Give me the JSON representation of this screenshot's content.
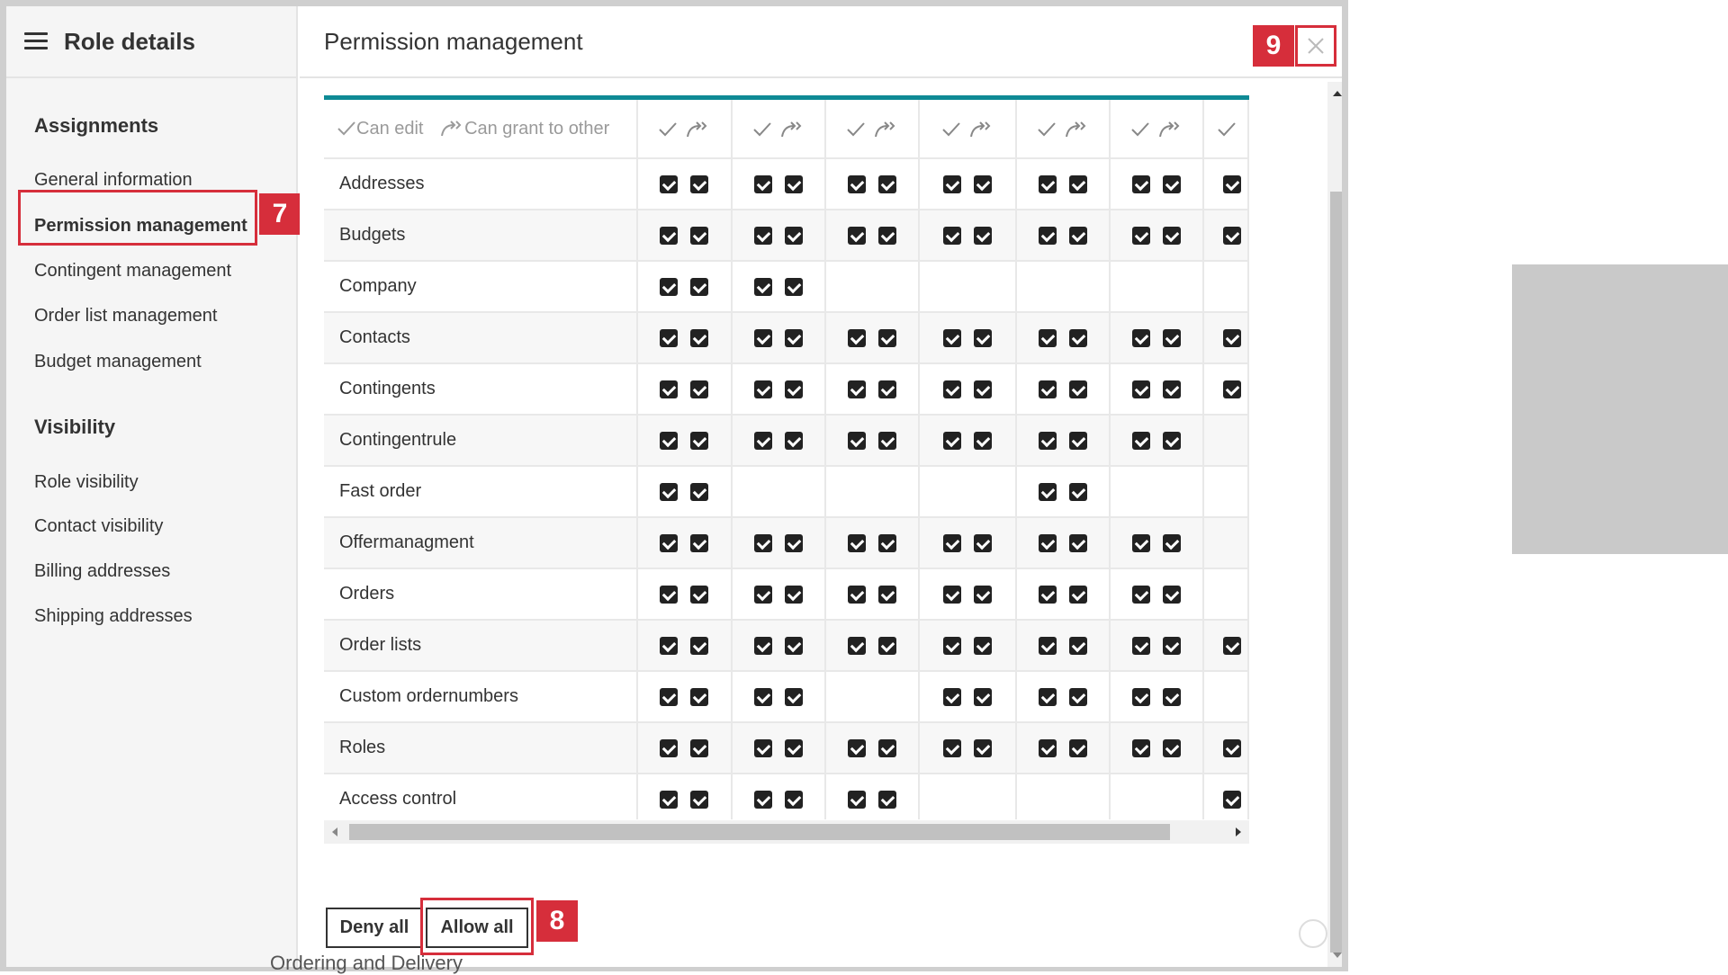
{
  "sidebar": {
    "title": "Role details",
    "sections": [
      {
        "title": "Assignments",
        "items": [
          "General information",
          "Permission management",
          "Contingent management",
          "Order list management",
          "Budget management"
        ]
      },
      {
        "title": "Visibility",
        "items": [
          "Role visibility",
          "Contact visibility",
          "Billing addresses",
          "Shipping addresses"
        ]
      }
    ],
    "active_item": "Permission management"
  },
  "main": {
    "title": "Permission management",
    "legend": {
      "can_edit": "Can edit",
      "can_grant": "Can grant to other"
    },
    "rows": [
      {
        "label": "Addresses",
        "cols": [
          true,
          true,
          true,
          true,
          true,
          true,
          true
        ]
      },
      {
        "label": "Budgets",
        "cols": [
          true,
          true,
          true,
          true,
          true,
          true,
          true
        ]
      },
      {
        "label": "Company",
        "cols": [
          true,
          true,
          false,
          false,
          false,
          false,
          false
        ]
      },
      {
        "label": "Contacts",
        "cols": [
          true,
          true,
          true,
          true,
          true,
          true,
          true
        ]
      },
      {
        "label": "Contingents",
        "cols": [
          true,
          true,
          true,
          true,
          true,
          true,
          true
        ]
      },
      {
        "label": "Contingentrule",
        "cols": [
          true,
          true,
          true,
          true,
          true,
          true,
          false
        ]
      },
      {
        "label": "Fast order",
        "cols": [
          true,
          false,
          false,
          false,
          true,
          false,
          false
        ]
      },
      {
        "label": "Offermanagment",
        "cols": [
          true,
          true,
          true,
          true,
          true,
          true,
          false
        ]
      },
      {
        "label": "Orders",
        "cols": [
          true,
          true,
          true,
          true,
          true,
          true,
          false
        ]
      },
      {
        "label": "Order lists",
        "cols": [
          true,
          true,
          true,
          true,
          true,
          true,
          true
        ]
      },
      {
        "label": "Custom ordernumbers",
        "cols": [
          true,
          true,
          false,
          true,
          true,
          true,
          false
        ]
      },
      {
        "label": "Roles",
        "cols": [
          true,
          true,
          true,
          true,
          true,
          true,
          true
        ]
      },
      {
        "label": "Access control",
        "cols": [
          true,
          true,
          true,
          false,
          false,
          false,
          true
        ]
      }
    ],
    "buttons": {
      "deny_all": "Deny all",
      "allow_all": "Allow all"
    }
  },
  "annotations": {
    "badge_7": "7",
    "badge_8": "8",
    "badge_9": "9"
  },
  "background": {
    "peek_text": "Ordering and Delivery"
  },
  "colors": {
    "highlight": "#d62e3b",
    "accent": "#0e8a95"
  }
}
